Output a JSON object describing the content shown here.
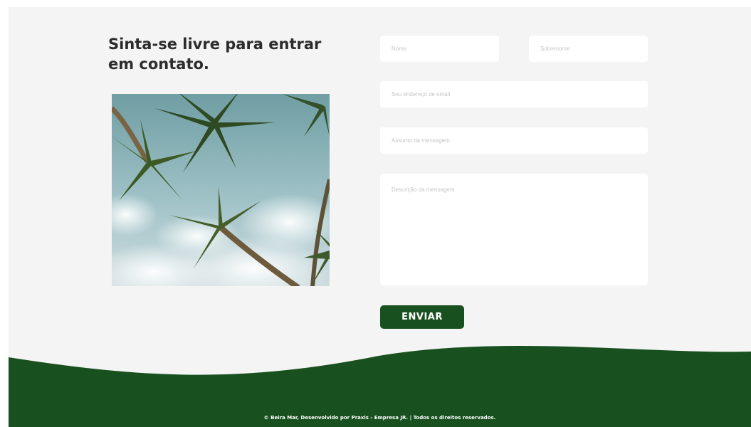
{
  "contact": {
    "heading": "Sinta-se livre para entrar em contato."
  },
  "form": {
    "first_name_placeholder": "Nome",
    "last_name_placeholder": "Sobrenome",
    "email_placeholder": "Seu endereço de email",
    "subject_placeholder": "Assunto da mensagem",
    "message_placeholder": "Descrição da mensagem",
    "submit_label": "ENVIAR"
  },
  "footer": {
    "copyright": "© Beira Mar, Desenvolvido por Praxis - Empresa JR. | Todos os direitos reservados."
  },
  "colors": {
    "brand_green": "#18511f",
    "panel_background": "#f4f4f4",
    "field_background": "#ffffff"
  }
}
